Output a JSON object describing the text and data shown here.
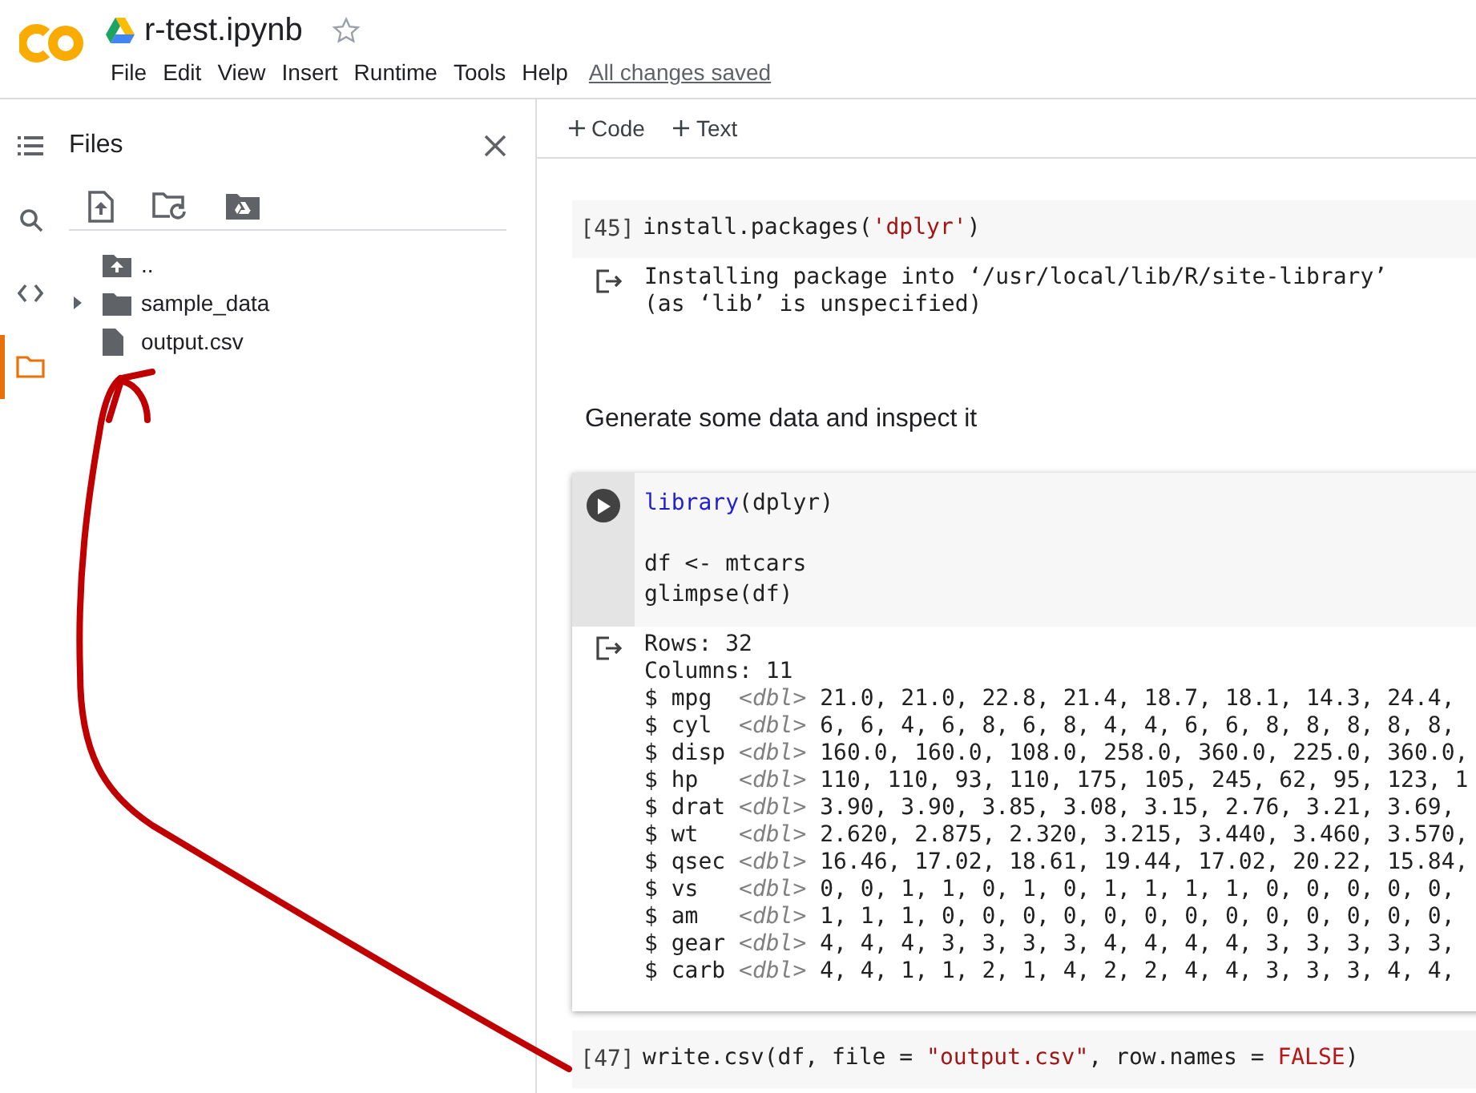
{
  "header": {
    "title": "r-test.ipynb",
    "starred": false,
    "menu": [
      "File",
      "Edit",
      "View",
      "Insert",
      "Runtime",
      "Tools",
      "Help"
    ],
    "save_status": "All changes saved"
  },
  "rail": [
    {
      "kind": "toc",
      "selected": false
    },
    {
      "kind": "search",
      "selected": false
    },
    {
      "kind": "snippets",
      "selected": false
    },
    {
      "kind": "files",
      "selected": true
    }
  ],
  "files": {
    "title": "Files",
    "tree": [
      {
        "kind": "parent",
        "name": ".."
      },
      {
        "kind": "folder",
        "name": "sample_data",
        "expanded": false
      },
      {
        "kind": "file",
        "name": "output.csv"
      }
    ]
  },
  "toolbar": [
    "Code",
    "Text"
  ],
  "cells": [
    {
      "kind": "code",
      "count": "[45]",
      "focused": false,
      "lines": [
        {
          "tokens": [
            {
              "kind": "plain",
              "text": "install.packages("
            },
            {
              "kind": "string",
              "text": "'dplyr'"
            },
            {
              "kind": "plain",
              "text": ")"
            }
          ]
        }
      ],
      "output": {
        "kind": "text",
        "lines": [
          "Installing package into ‘/usr/local/lib/R/site-library’",
          "(as ‘lib’ is unspecified)"
        ]
      }
    },
    {
      "kind": "markdown",
      "text": "Generate some data and inspect it"
    },
    {
      "kind": "code",
      "focused": true,
      "lines": [
        {
          "tokens": [
            {
              "kind": "keyword",
              "text": "library"
            },
            {
              "kind": "plain",
              "text": "(dplyr)"
            }
          ]
        },
        {
          "gap_before": true,
          "tokens": [
            {
              "kind": "plain",
              "text": "df <- mtcars"
            }
          ]
        },
        {
          "tokens": [
            {
              "kind": "plain",
              "text": "glimpse(df)"
            }
          ]
        }
      ],
      "output": {
        "kind": "glimpse",
        "lines": [
          "Rows: 32",
          "Columns: 11"
        ],
        "columns": [
          {
            "marker": "$",
            "name": "mpg",
            "type": "<dbl>",
            "values": "21.0, 21.0, 22.8, 21.4, 18.7, 18.1, 14.3, 24.4,"
          },
          {
            "marker": "$",
            "name": "cyl",
            "type": "<dbl>",
            "values": "6, 6, 4, 6, 8, 6, 8, 4, 4, 6, 6, 8, 8, 8, 8, 8,"
          },
          {
            "marker": "$",
            "name": "disp",
            "type": "<dbl>",
            "values": "160.0, 160.0, 108.0, 258.0, 360.0, 225.0, 360.0,"
          },
          {
            "marker": "$",
            "name": "hp",
            "type": "<dbl>",
            "values": "110, 110, 93, 110, 175, 105, 245, 62, 95, 123, 1"
          },
          {
            "marker": "$",
            "name": "drat",
            "type": "<dbl>",
            "values": "3.90, 3.90, 3.85, 3.08, 3.15, 2.76, 3.21, 3.69,"
          },
          {
            "marker": "$",
            "name": "wt",
            "type": "<dbl>",
            "values": "2.620, 2.875, 2.320, 3.215, 3.440, 3.460, 3.570,"
          },
          {
            "marker": "$",
            "name": "qsec",
            "type": "<dbl>",
            "values": "16.46, 17.02, 18.61, 19.44, 17.02, 20.22, 15.84,"
          },
          {
            "marker": "$",
            "name": "vs",
            "type": "<dbl>",
            "values": "0, 0, 1, 1, 0, 1, 0, 1, 1, 1, 1, 0, 0, 0, 0, 0,"
          },
          {
            "marker": "$",
            "name": "am",
            "type": "<dbl>",
            "values": "1, 1, 1, 0, 0, 0, 0, 0, 0, 0, 0, 0, 0, 0, 0, 0,"
          },
          {
            "marker": "$",
            "name": "gear",
            "type": "<dbl>",
            "values": "4, 4, 4, 3, 3, 3, 3, 4, 4, 4, 4, 3, 3, 3, 3, 3,"
          },
          {
            "marker": "$",
            "name": "carb",
            "type": "<dbl>",
            "values": "4, 4, 1, 1, 2, 1, 4, 2, 2, 4, 4, 3, 3, 3, 4, 4,"
          }
        ]
      }
    },
    {
      "kind": "code",
      "count": "[47]",
      "focused": false,
      "lines": [
        {
          "tokens": [
            {
              "kind": "plain",
              "text": "write.csv(df, file = "
            },
            {
              "kind": "string",
              "text": "\"output.csv\""
            },
            {
              "kind": "plain",
              "text": ", row.names = "
            },
            {
              "kind": "constant",
              "text": "FALSE"
            },
            {
              "kind": "plain",
              "text": ")"
            }
          ]
        }
      ]
    }
  ]
}
